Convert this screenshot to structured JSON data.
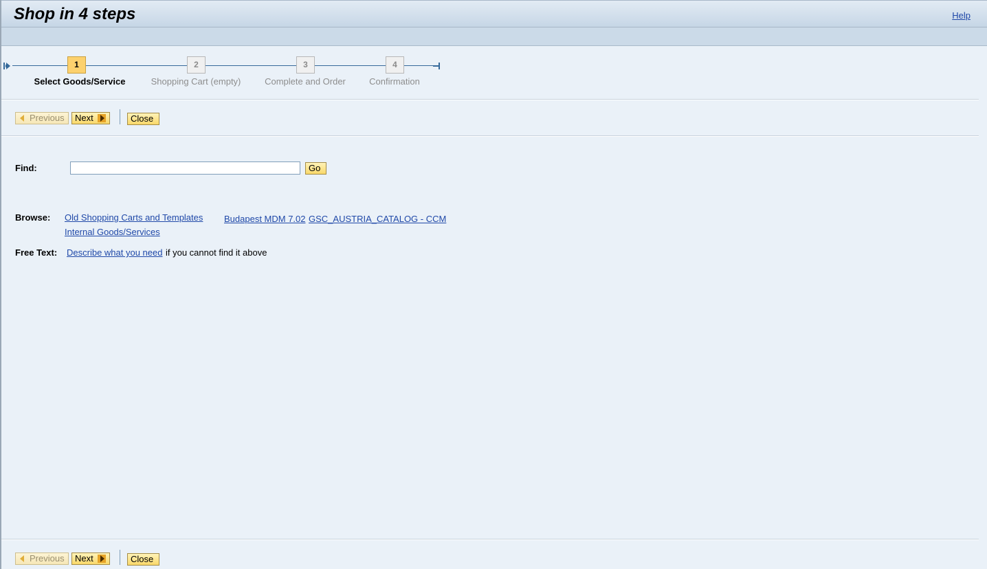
{
  "header": {
    "title": "Shop in 4 steps",
    "help_label": "Help"
  },
  "roadmap": {
    "steps": [
      {
        "number": "1",
        "label": "Select Goods/Service",
        "state": "active"
      },
      {
        "number": "2",
        "label": "Shopping Cart (empty)",
        "state": "inactive"
      },
      {
        "number": "3",
        "label": "Complete and Order",
        "state": "inactive"
      },
      {
        "number": "4",
        "label": "Confirmation",
        "state": "inactive"
      }
    ]
  },
  "toolbar": {
    "previous_label": "Previous",
    "next_label": "Next",
    "close_label": "Close"
  },
  "find": {
    "label": "Find:",
    "value": "",
    "go_label": "Go"
  },
  "browse": {
    "label": "Browse:",
    "links": [
      "Old Shopping Carts and Templates",
      "Internal Goods/Services",
      "Budapest MDM 7.02",
      "GSC_AUSTRIA_CATALOG - CCM"
    ]
  },
  "free_text": {
    "label": "Free Text:",
    "link": "Describe what you need",
    "suffix": "if you cannot find it above"
  },
  "colors": {
    "accent_step": "#fcd16e",
    "link": "#1f48a8",
    "background": "#eaf1f8"
  }
}
